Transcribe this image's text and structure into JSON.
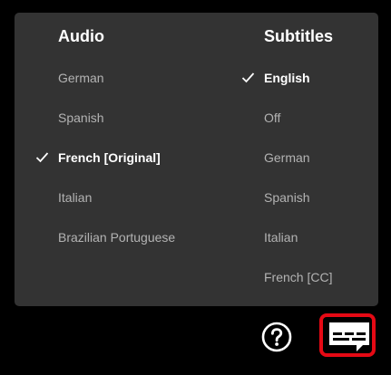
{
  "audio": {
    "header": "Audio",
    "items": [
      {
        "label": "German",
        "selected": false
      },
      {
        "label": "Spanish",
        "selected": false
      },
      {
        "label": "French [Original]",
        "selected": true
      },
      {
        "label": "Italian",
        "selected": false
      },
      {
        "label": "Brazilian Portuguese",
        "selected": false
      }
    ]
  },
  "subtitles": {
    "header": "Subtitles",
    "items": [
      {
        "label": "English",
        "selected": true
      },
      {
        "label": "Off",
        "selected": false
      },
      {
        "label": "German",
        "selected": false
      },
      {
        "label": "Spanish",
        "selected": false
      },
      {
        "label": "Italian",
        "selected": false
      },
      {
        "label": "French [CC]",
        "selected": false
      }
    ]
  },
  "controls": {
    "help_icon": "help-circle-icon",
    "subtitles_icon": "subtitles-icon",
    "active_outline_color": "#e50914"
  },
  "colors": {
    "panel_background": "#333333",
    "text_selected": "#ffffff",
    "text_unselected": "#b3b3b3"
  }
}
